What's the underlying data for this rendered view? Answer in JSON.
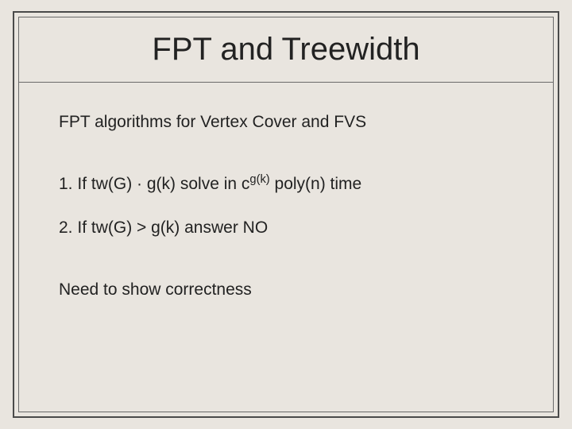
{
  "title": "FPT and Treewidth",
  "intro": "FPT algorithms for Vertex Cover and FVS",
  "items": [
    {
      "num": "1.",
      "pre": "If tw(G) ",
      "op": "·",
      "mid": " g(k) solve in c",
      "sup": "g(k)",
      "post": " poly(n) time"
    },
    {
      "num": "2.",
      "text": "If tw(G) > g(k) answer NO"
    }
  ],
  "closing": "Need to show correctness"
}
